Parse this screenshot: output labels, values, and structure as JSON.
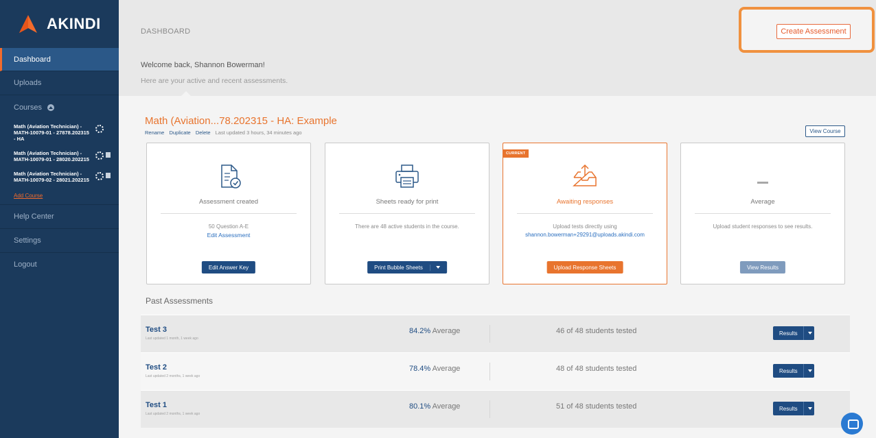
{
  "brand": {
    "name": "AKINDI",
    "accent": "#f26b2c",
    "sidebar_bg": "#1b3a5c"
  },
  "sidebar": {
    "dashboard": "Dashboard",
    "uploads": "Uploads",
    "courses": "Courses",
    "course_items": [
      {
        "label": "Math (Aviation Technician) - MATH-10079-01 - 27878.202315 - HA"
      },
      {
        "label": "Math (Aviation Technician) - MATH-10079-01 - 28020.202215"
      },
      {
        "label": "Math (Aviation Technician) - MATH-10079-02 - 28021.202215"
      }
    ],
    "add_course": "Add Course",
    "help_center": "Help Center",
    "settings": "Settings",
    "logout": "Logout"
  },
  "header": {
    "breadcrumb": "DASHBOARD",
    "create_label": "Create Assessment",
    "welcome": "Welcome back, Shannon Bowerman!",
    "subtitle": "Here are your active and recent assessments."
  },
  "assessment": {
    "title": "Math (Aviation...78.202315 - HA: Example",
    "rename": "Rename",
    "duplicate": "Duplicate",
    "delete": "Delete",
    "updated": "Last updated 3 hours, 34 minutes ago",
    "view_course": "View Course",
    "cards": [
      {
        "icon": "document-check-icon",
        "title": "Assessment created",
        "text": "50 Question A-E",
        "link": "Edit Assessment",
        "button": "Edit Answer Key"
      },
      {
        "icon": "printer-icon",
        "title": "Sheets ready for print",
        "text": "There are 48 active students in the course.",
        "button": "Print Bubble Sheets"
      },
      {
        "icon": "inbox-upload-icon",
        "badge": "CURRENT",
        "title": "Awaiting responses",
        "text": "Upload tests directly using",
        "email": "shannon.bowerman+29291@uploads.akindi.com",
        "button": "Upload Response Sheets"
      },
      {
        "icon": "dash-icon",
        "title": "Average",
        "text": "Upload student responses to see results.",
        "button": "View Results"
      }
    ]
  },
  "past": {
    "title": "Past Assessments",
    "rows": [
      {
        "name": "Test 3",
        "updated": "Last updated 1 month, 1 week ago",
        "avg_value": "84.2%",
        "avg_label": "Average",
        "tested": "46 of 48 students tested",
        "button": "Results"
      },
      {
        "name": "Test 2",
        "updated": "Last updated 2 months, 1 week ago",
        "avg_value": "78.4%",
        "avg_label": "Average",
        "tested": "48 of 48 students tested",
        "button": "Results"
      },
      {
        "name": "Test 1",
        "updated": "Last updated 2 months, 1 week ago",
        "avg_value": "80.1%",
        "avg_label": "Average",
        "tested": "51 of 48 students tested",
        "button": "Results"
      }
    ]
  }
}
